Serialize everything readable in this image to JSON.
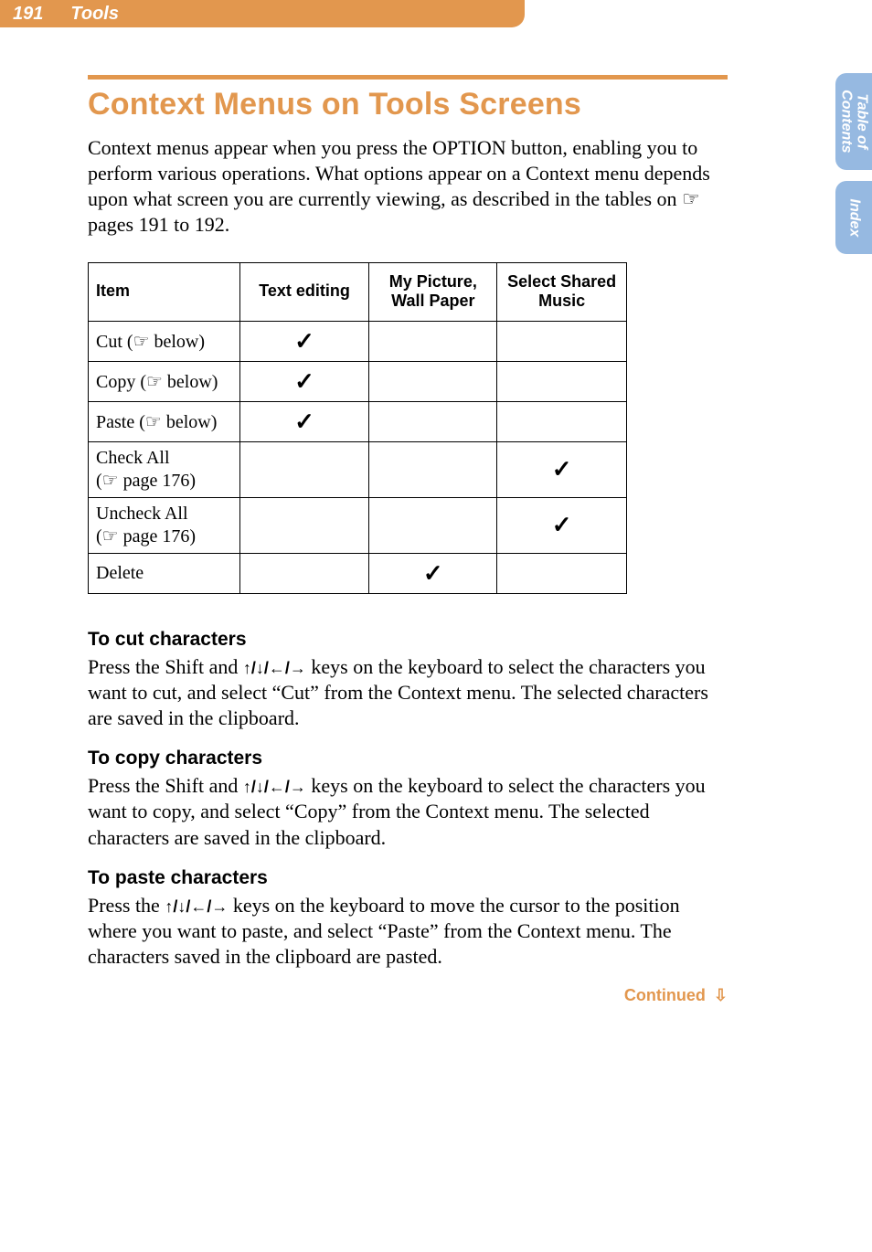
{
  "header": {
    "page_number": "191",
    "section": "Tools"
  },
  "side_tabs": {
    "toc_line1": "Table of",
    "toc_line2": "Contents",
    "index": "Index"
  },
  "title": "Context Menus on Tools Screens",
  "intro": "Context menus appear when you press the OPTION button, enabling you to perform various operations. What options appear on a Context menu depends upon what screen you are currently viewing, as described in the tables on ☞ pages 191 to 192.",
  "table": {
    "headers": {
      "item": "Item",
      "col2": "Text editing",
      "col3": "My Picture, Wall Paper",
      "col4": "Select Shared Music"
    },
    "rows": [
      {
        "item_main": "Cut (",
        "item_ref": "☞ below)",
        "c2": "✓",
        "c3": "",
        "c4": ""
      },
      {
        "item_main": "Copy (",
        "item_ref": "☞ below)",
        "c2": "✓",
        "c3": "",
        "c4": ""
      },
      {
        "item_main": "Paste (",
        "item_ref": "☞ below)",
        "c2": "✓",
        "c3": "",
        "c4": ""
      },
      {
        "item_main": "Check All",
        "item_ref": "(☞ page 176)",
        "multiline": true,
        "c2": "",
        "c3": "",
        "c4": "✓"
      },
      {
        "item_main": "Uncheck All",
        "item_ref": "(☞ page 176)",
        "multiline": true,
        "c2": "",
        "c3": "",
        "c4": "✓"
      },
      {
        "item_main": "Delete",
        "item_ref": "",
        "c2": "",
        "c3": "✓",
        "c4": ""
      }
    ]
  },
  "sections": [
    {
      "heading": "To cut characters",
      "body_pre": "Press the Shift and ",
      "arrows": "↑/↓/←/→",
      "body_post": " keys on the keyboard to select the characters you want to cut, and select “Cut” from the Context menu. The selected characters are saved in the clipboard."
    },
    {
      "heading": "To copy characters",
      "body_pre": "Press the Shift and ",
      "arrows": "↑/↓/←/→",
      "body_post": " keys on the keyboard to select the characters you want to copy, and select “Copy” from the Context menu. The selected characters are saved in the clipboard."
    },
    {
      "heading": "To paste characters",
      "body_pre": "Press the ",
      "arrows": "↑/↓/←/→",
      "body_post": " keys on the keyboard to move the cursor to the position where you want to paste, and select “Paste” from the Context menu. The characters saved in the clipboard are pasted."
    }
  ],
  "continued": "Continued"
}
